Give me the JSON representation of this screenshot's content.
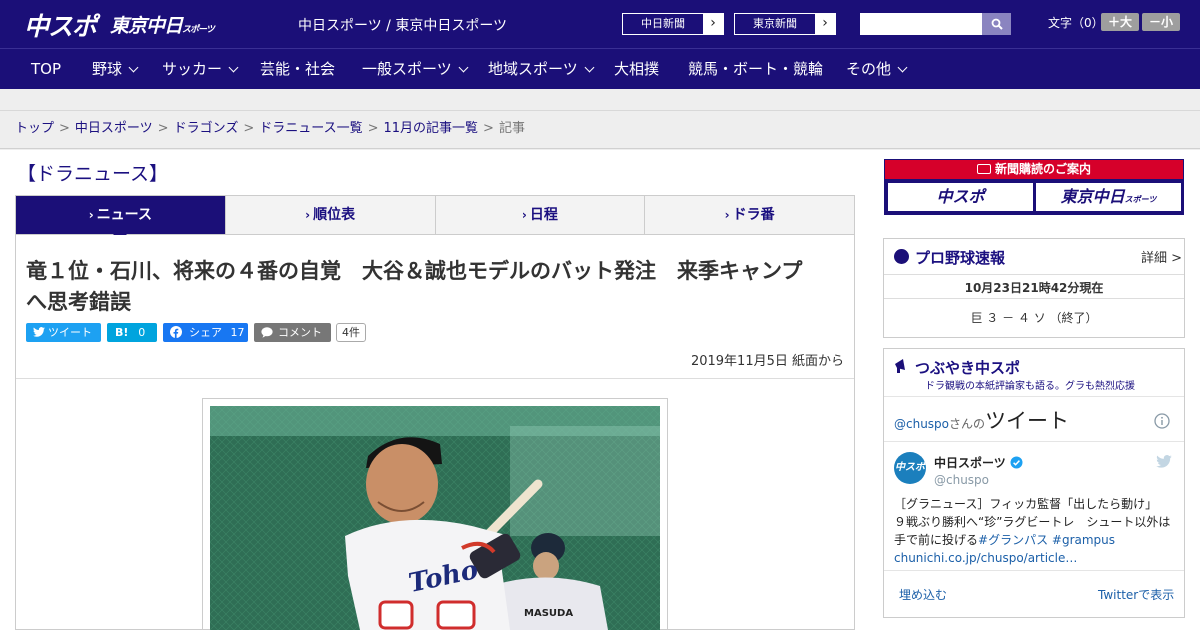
{
  "header": {
    "logo_chuspo": "中スポ",
    "logo_tokyo": "東京中日",
    "logo_tokyo_small": "スポーツ",
    "site_label": "中日スポーツ / 東京中日スポーツ",
    "paper_links": [
      {
        "label": "中日新聞",
        "arrow": "›"
      },
      {
        "label": "東京新聞",
        "arrow": "›"
      }
    ],
    "search": {
      "placeholder": "",
      "icon": "search-icon"
    },
    "font_size": {
      "label": "文字（0）",
      "bigger": "＋大",
      "smaller": "－小"
    }
  },
  "nav": {
    "items": [
      {
        "label": "TOP",
        "dropdown": false
      },
      {
        "label": "野球",
        "dropdown": true
      },
      {
        "label": "サッカー",
        "dropdown": true
      },
      {
        "label": "芸能・社会",
        "dropdown": false
      },
      {
        "label": "一般スポーツ",
        "dropdown": true
      },
      {
        "label": "地域スポーツ",
        "dropdown": true
      },
      {
        "label": "大相撲",
        "dropdown": false
      },
      {
        "label": "競馬・ボート・競輪",
        "dropdown": false
      },
      {
        "label": "その他",
        "dropdown": true
      }
    ]
  },
  "breadcrumb": {
    "items": [
      "トップ",
      "中日スポーツ",
      "ドラゴンズ",
      "ドラニュース一覧",
      "11月の記事一覧"
    ],
    "current": "記事",
    "separator": ">"
  },
  "section_title": "【ドラニュース】",
  "tabs": [
    {
      "label": "ニュース",
      "active": true
    },
    {
      "label": "順位表",
      "active": false
    },
    {
      "label": "日程",
      "active": false
    },
    {
      "label": "ドラ番",
      "active": false
    }
  ],
  "article": {
    "headline_line1": "竜１位・石川、将来の４番の自覚　大谷＆誠也モデルのバット発注　来季キャンプ",
    "headline_line2": "へ思考錯誤",
    "share": {
      "tweet_label": "ツイート",
      "hatena_label": "B!",
      "hatena_count": "0",
      "facebook_label": "シェア",
      "facebook_count": "17",
      "comment_label": "コメント",
      "comment_count": "4件"
    },
    "dateline": "2019年11月5日 紙面から",
    "photo_text": "MASUDA"
  },
  "sidebar": {
    "promo": {
      "title": "新聞購読のご案内",
      "logo_left": "中スポ",
      "logo_right": "東京中日",
      "logo_right_small": "スポーツ"
    },
    "baseball": {
      "title": "プロ野球速報",
      "detail_link": "詳細 >",
      "updated": "10月23日21時42分現在",
      "score": "巨 ３ － ４ ソ （終了）"
    },
    "tweets": {
      "title": "つぶやき中スポ",
      "subtitle": "ドラ観戦の本紙評論家も語る。グラも熱烈応援",
      "handle_prefix": "@chuspo",
      "handle_suffix": "さんの",
      "heading": "ツイート",
      "author_name": "中日スポーツ",
      "author_handle": "@chuspo",
      "avatar_text": "中スポ",
      "text_line1": "［グラニュース］フィッカ監督「出したら動け」",
      "text_line2": "９戦ぶり勝利へ“珍”ラグビートレ　シュート以外は",
      "text_line3_plain": "手で前に投げる",
      "hashtag1": "#グランパス",
      "hashtag2": "#grampus",
      "link": "chunichi.co.jp/chuspo/article…",
      "embed_label": "埋め込む",
      "view_on_twitter": "Twitterで表示"
    }
  },
  "colors": {
    "brand_navy": "#1b0f78",
    "link_blue": "#1b1080",
    "twitter": "#1da1f2",
    "hatena": "#00a4de",
    "facebook": "#1877f2",
    "comment_gray": "#777777",
    "promo_red": "#d6002a"
  }
}
